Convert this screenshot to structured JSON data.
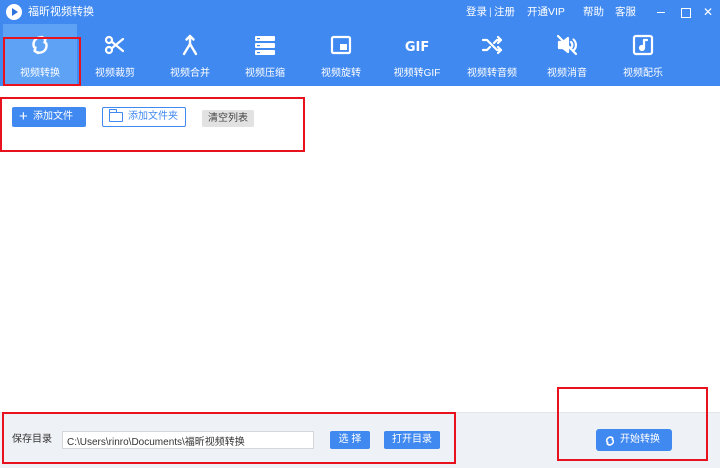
{
  "titlebar": {
    "title": "福昕视频转换",
    "login": "登录",
    "separator": "|",
    "register": "注册",
    "vip": "开通VIP",
    "help": "帮助",
    "service": "客服"
  },
  "toolbar": {
    "tools": [
      {
        "label": "视频转换",
        "icon": "convert-icon",
        "active": true
      },
      {
        "label": "视频裁剪",
        "icon": "scissors-icon",
        "active": false
      },
      {
        "label": "视频合并",
        "icon": "merge-icon",
        "active": false
      },
      {
        "label": "视频压缩",
        "icon": "compress-icon",
        "active": false
      },
      {
        "label": "视频旋转",
        "icon": "rotate-icon",
        "active": false
      },
      {
        "label": "视频转GIF",
        "icon": "gif-icon",
        "gif_text": "GIF",
        "active": false
      },
      {
        "label": "视频转音频",
        "icon": "shuffle-icon",
        "active": false
      },
      {
        "label": "视频消音",
        "icon": "mute-icon",
        "active": false
      },
      {
        "label": "视频配乐",
        "icon": "music-icon",
        "active": false
      }
    ]
  },
  "actions": {
    "add_file": "添加文件",
    "add_folder": "添加文件夹",
    "clear_list": "清空列表"
  },
  "bottom": {
    "save_label": "保存目录",
    "save_path": "C:\\Users\\rinro\\Documents\\福昕视频转换",
    "choose": "选 择",
    "open_dir": "打开目录",
    "start": "开始转换"
  },
  "colors": {
    "accent": "#4089f0",
    "active_tab": "#5ea2f6",
    "highlight": "#e8121e",
    "bottom_bg": "#eef1f5"
  }
}
